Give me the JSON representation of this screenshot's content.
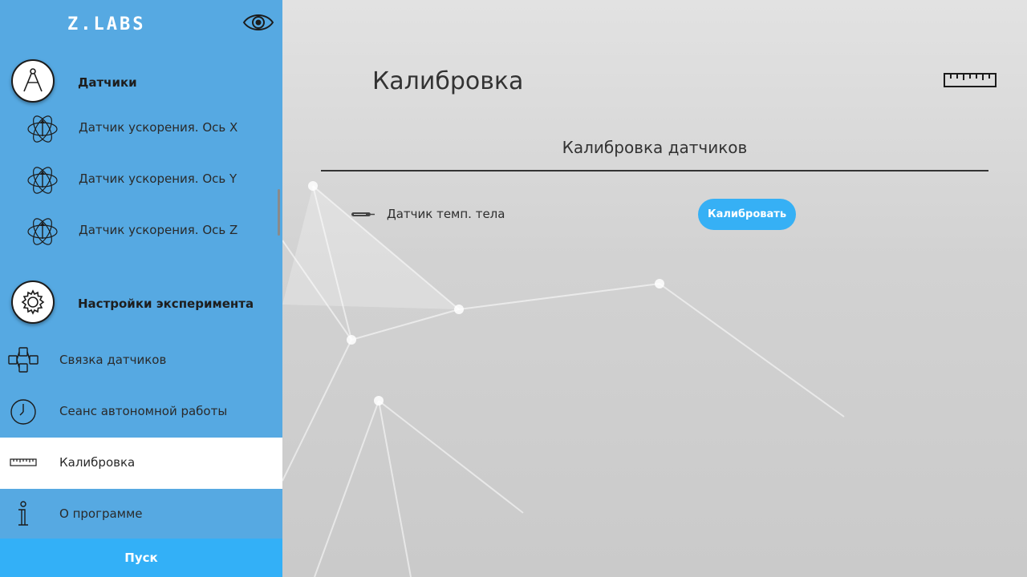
{
  "app": {
    "logo": "Z.LABS",
    "view_icon": "eye-icon"
  },
  "sidebar": {
    "sensors_section": {
      "label": "Датчики",
      "icon": "compass-icon",
      "items": [
        {
          "label": "Датчик ускорения. Ось X",
          "icon": "accelerometer-icon"
        },
        {
          "label": "Датчик ускорения. Ось Y",
          "icon": "accelerometer-icon"
        },
        {
          "label": "Датчик ускорения. Ось Z",
          "icon": "accelerometer-icon"
        }
      ]
    },
    "settings_section": {
      "label": "Настройки эксперимента",
      "icon": "gear-icon"
    },
    "menu": [
      {
        "label": "Связка датчиков",
        "icon": "hierarchy-icon",
        "active": false
      },
      {
        "label": "Сеанс автономной работы",
        "icon": "clock-icon",
        "active": false
      },
      {
        "label": "Калибровка",
        "icon": "ruler-icon",
        "active": true
      },
      {
        "label": "О программе",
        "icon": "info-icon",
        "active": false
      }
    ],
    "start_label": "Пуск"
  },
  "main": {
    "title": "Калибровка",
    "title_icon": "ruler-icon",
    "panel_title": "Калибровка датчиков",
    "rows": [
      {
        "label": "Датчик темп. тела",
        "icon": "thermometer-icon",
        "button_label": "Калибровать"
      }
    ]
  },
  "colors": {
    "sidebar_bg": "#56a9e2",
    "accent": "#36b0f5",
    "active_bg": "#ffffff"
  }
}
